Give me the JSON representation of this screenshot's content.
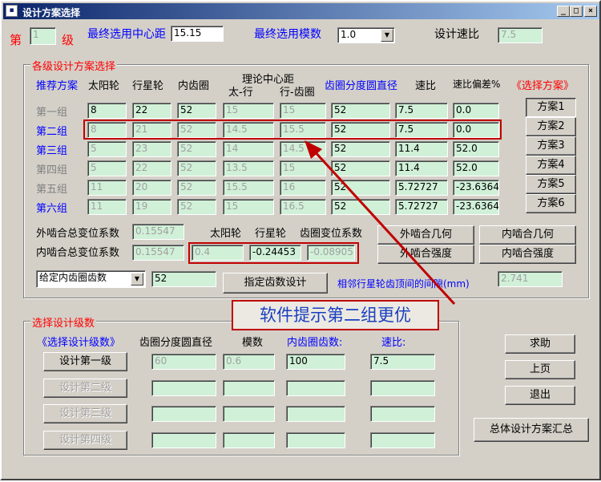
{
  "window": {
    "title": "设计方案选择",
    "controls": [
      "_",
      "□",
      "×"
    ]
  },
  "top": {
    "stage_prefix": "第",
    "stage_value": "1",
    "stage_suffix": "级",
    "center_distance_label": "最终选用中心距",
    "center_distance_value": "15.15",
    "module_label": "最终选用模数",
    "module_value": "1.0",
    "speed_ratio_label": "设计速比",
    "speed_ratio_value": "7.5"
  },
  "stage_group": {
    "title": "各级设计方案选择",
    "headers": {
      "recommend": "推荐方案",
      "sun": "太阳轮",
      "planet": "行星轮",
      "inner_ring": "内齿圈",
      "theory_cd": "理论中心距",
      "sun_planet": "太-行",
      "planet_ring": "行-齿圈",
      "ring_pitch_dia": "齿圈分度圆直径",
      "ratio": "速比",
      "ratio_dev": "速比偏差%",
      "select_plan": "《选择方案》"
    },
    "rows": [
      {
        "name": "第一组",
        "sun": "8",
        "planet": "22",
        "ring": "52",
        "cd1": "15",
        "cd2": "15",
        "dia": "52",
        "ratio": "7.5",
        "dev": "0.0",
        "plan": "方案1"
      },
      {
        "name": "第二组",
        "sun": "8",
        "planet": "21",
        "ring": "52",
        "cd1": "14.5",
        "cd2": "15.5",
        "dia": "52",
        "ratio": "7.5",
        "dev": "0.0",
        "plan": "方案2"
      },
      {
        "name": "第三组",
        "sun": "5",
        "planet": "23",
        "ring": "52",
        "cd1": "14",
        "cd2": "14.5",
        "dia": "52",
        "ratio": "11.4",
        "dev": "52.0",
        "plan": "方案3"
      },
      {
        "name": "第四组",
        "sun": "5",
        "planet": "22",
        "ring": "52",
        "cd1": "13.5",
        "cd2": "15",
        "dia": "52",
        "ratio": "11.4",
        "dev": "52.0",
        "plan": "方案4"
      },
      {
        "name": "第五组",
        "sun": "11",
        "planet": "20",
        "ring": "52",
        "cd1": "15.5",
        "cd2": "16",
        "dia": "52",
        "ratio": "5.72727",
        "dev": "-23.6364",
        "plan": "方案5"
      },
      {
        "name": "第六组",
        "sun": "11",
        "planet": "19",
        "ring": "52",
        "cd1": "15",
        "cd2": "16.5",
        "dia": "52",
        "ratio": "5.72727",
        "dev": "-23.6364",
        "plan": "方案6"
      }
    ],
    "ext_coeff_label": "外啮合总变位系数",
    "ext_coeff_value": "0.15547",
    "int_coeff_label": "内啮合总变位系数",
    "int_coeff_value": "0.15547",
    "sub_sun": "太阳轮",
    "sub_planet": "行星轮",
    "sub_ring": "齿圈变位系数",
    "sun_coeff": "0.4",
    "planet_coeff": "-0.24453",
    "ring_coeff": "-0.08905",
    "btn_ext_geom": "外啮合几何",
    "btn_int_geom": "内啮合几何",
    "btn_ext_strength": "外啮合强度",
    "btn_int_strength": "内啮合强度",
    "given_select": "给定内齿圈齿数",
    "given_value": "52",
    "btn_assign": "指定齿数设计",
    "gap_label": "相邻行星轮齿顶间的间隙(mm)",
    "gap_value": "2.741"
  },
  "callout": "软件提示第二组更优",
  "select_group": {
    "title": "选择设计级数",
    "header_select": "《选择设计级数》",
    "header_dia": "齿圈分度圆直径",
    "header_module": "模数",
    "header_teeth": "内齿圈齿数:",
    "header_ratio": "速比:",
    "stages": [
      {
        "label": "设计第一级",
        "dia": "60",
        "module": "0.6",
        "teeth": "100",
        "ratio": "7.5"
      },
      {
        "label": "设计第二级",
        "dia": "",
        "module": "",
        "teeth": "",
        "ratio": ""
      },
      {
        "label": "设计第三级",
        "dia": "",
        "module": "",
        "teeth": "",
        "ratio": ""
      },
      {
        "label": "设计第四级",
        "dia": "",
        "module": "",
        "teeth": "",
        "ratio": ""
      }
    ]
  },
  "side_buttons": {
    "help": "求助",
    "prev": "上页",
    "exit": "退出",
    "summary": "总体设计方案汇总"
  },
  "colors": {
    "field_bg": "#d0f0d8",
    "highlight": "#c00000",
    "window_bg": "#d4d0c8",
    "label_blue": "#0000ff",
    "label_red": "#ff0000"
  }
}
